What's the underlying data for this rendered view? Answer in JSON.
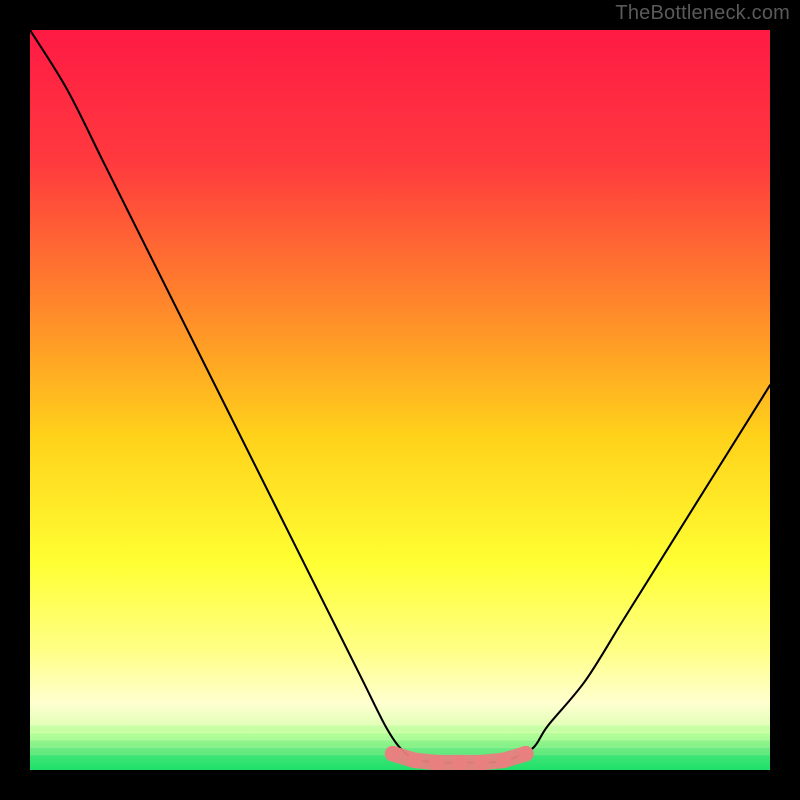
{
  "watermark": "TheBottleneck.com",
  "colors": {
    "background": "#000000",
    "gradient_top": "#ff1a44",
    "gradient_mid_upper": "#ff6a3a",
    "gradient_mid": "#ffd21a",
    "gradient_lower": "#ffff66",
    "gradient_pale": "#ffffcc",
    "gradient_bottom": "#1fe06a",
    "curve": "#000000",
    "highlight_dots": "#e98080"
  },
  "chart_data": {
    "type": "line",
    "title": "",
    "xlabel": "",
    "ylabel": "",
    "xlim": [
      0,
      100
    ],
    "ylim": [
      0,
      100
    ],
    "series": [
      {
        "name": "bottleneck-curve",
        "x": [
          0,
          5,
          10,
          15,
          20,
          25,
          30,
          35,
          40,
          45,
          48,
          50,
          52,
          55,
          58,
          60,
          62,
          65,
          68,
          70,
          75,
          80,
          85,
          90,
          95,
          100
        ],
        "values": [
          100,
          92,
          82,
          72,
          62,
          52,
          42,
          32,
          22,
          12,
          6,
          3,
          1.5,
          1,
          1,
          1,
          1,
          1.5,
          3,
          6,
          12,
          20,
          28,
          36,
          44,
          52
        ]
      }
    ],
    "optimal_markers": {
      "name": "optimal-range-dots",
      "x": [
        49,
        52,
        55,
        58,
        61,
        64,
        67
      ],
      "values": [
        2.2,
        1.3,
        1.0,
        1.0,
        1.0,
        1.3,
        2.2
      ]
    }
  }
}
